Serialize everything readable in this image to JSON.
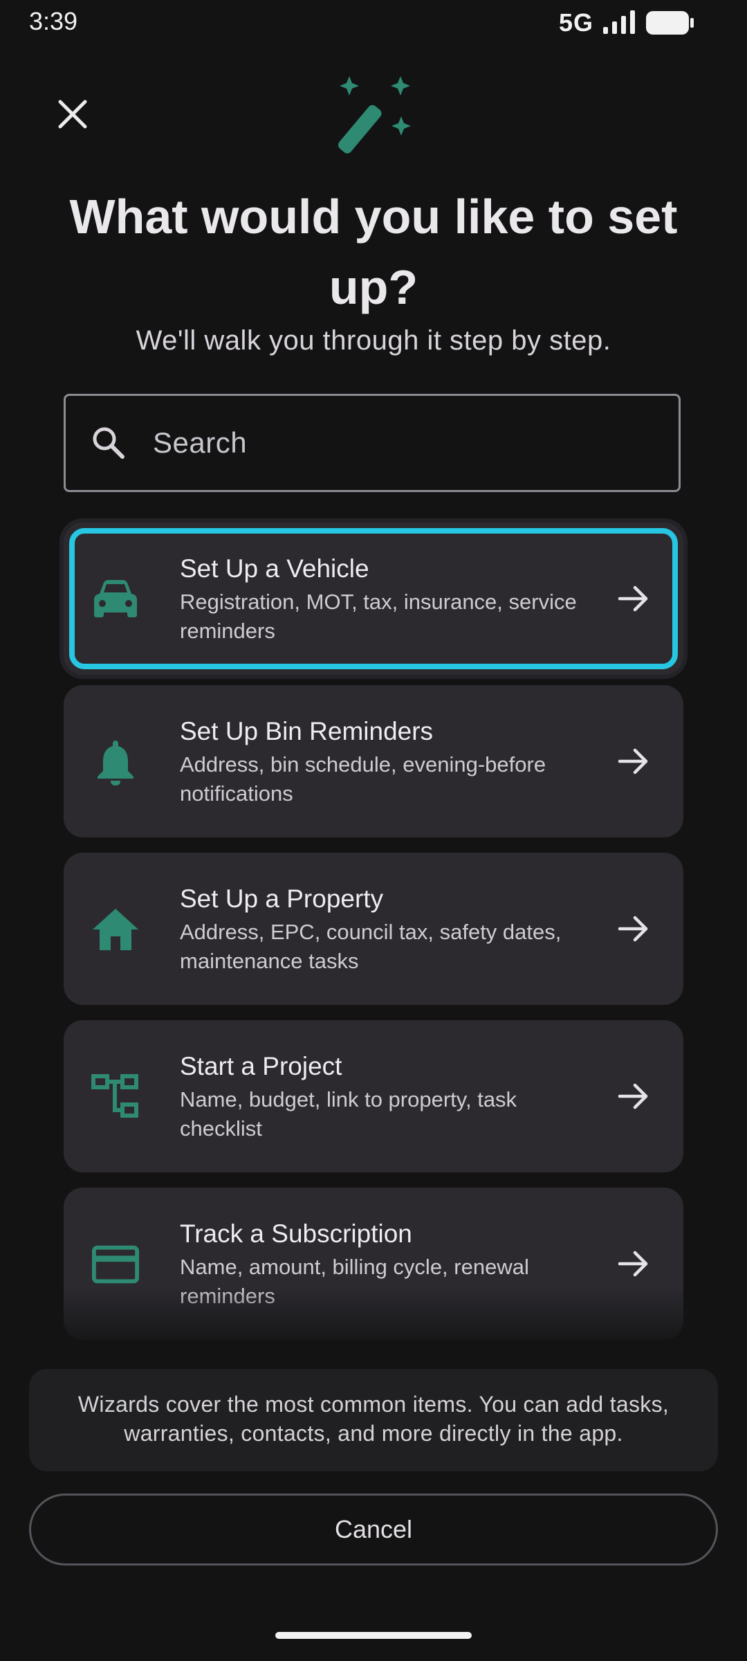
{
  "status_bar": {
    "time": "3:39",
    "network": "5G"
  },
  "header": {
    "title": "What would you like to set up?",
    "subtitle": "We'll walk you through it step by step."
  },
  "search": {
    "placeholder": "Search",
    "value": ""
  },
  "wizards": [
    {
      "title": "Set Up a Vehicle",
      "description": "Registration, MOT, tax, insurance, service reminders",
      "icon": "car-icon",
      "selected": true
    },
    {
      "title": "Set Up Bin Reminders",
      "description": "Address, bin schedule, evening-before notifications",
      "icon": "bell-icon",
      "selected": false
    },
    {
      "title": "Set Up a Property",
      "description": "Address, EPC, council tax, safety dates, maintenance tasks",
      "icon": "house-icon",
      "selected": false
    },
    {
      "title": "Start a Project",
      "description": "Name, budget, link to property, task checklist",
      "icon": "project-tree-icon",
      "selected": false
    },
    {
      "title": "Track a Subscription",
      "description": "Name, amount, billing cycle, renewal reminders",
      "icon": "credit-card-icon",
      "selected": false
    }
  ],
  "info_note": "Wizards cover the most common items. You can add tasks, warranties, contacts, and more directly in the app.",
  "cancel_label": "Cancel",
  "colors": {
    "background": "#131314",
    "card": "#2c2a2f",
    "accent_teal": "#2e8a72",
    "selection_cyan": "#27c6e2"
  }
}
